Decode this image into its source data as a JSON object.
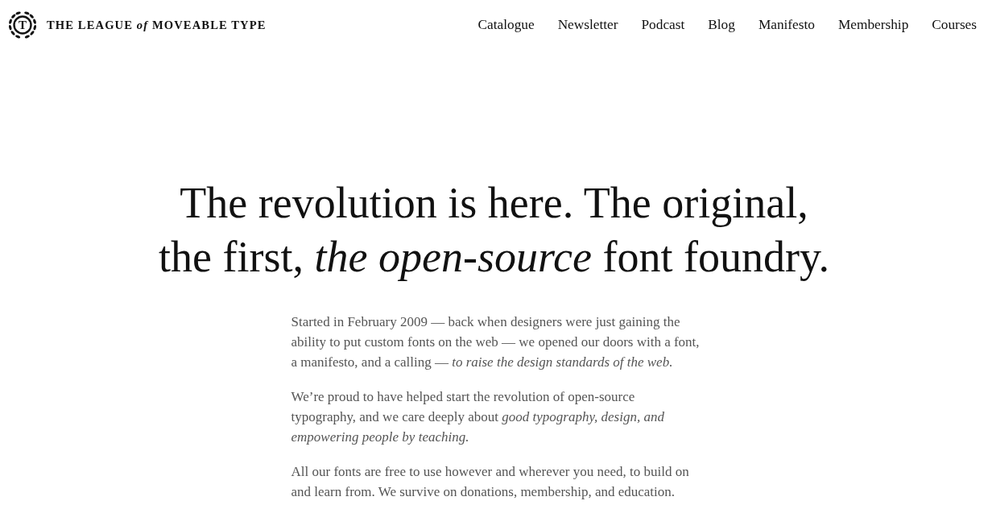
{
  "header": {
    "logo": {
      "monogram": "T",
      "wordmark": "THE LEAGUE *of* MOVEABLE TYPE"
    },
    "nav": [
      "Catalogue",
      "Newsletter",
      "Podcast",
      "Blog",
      "Manifesto",
      "Membership",
      "Courses"
    ]
  },
  "hero": {
    "headline": "The revolution is here. The original, the first, *the open-source* font foundry.",
    "paragraphs": [
      "Started in February 2009 — back when designers were just gaining the ability to put custom fonts on the web — we opened our doors with a font, a manifesto, and a calling — *to raise the design standards of the web.*",
      "We’re proud to have helped start the revolution of open-source typography, and we care deeply about *good typography, design, and empowering people by teaching.*",
      "All our fonts are free to use however and wherever you need, to build on and learn from. We survive on donations, membership, and education."
    ]
  }
}
